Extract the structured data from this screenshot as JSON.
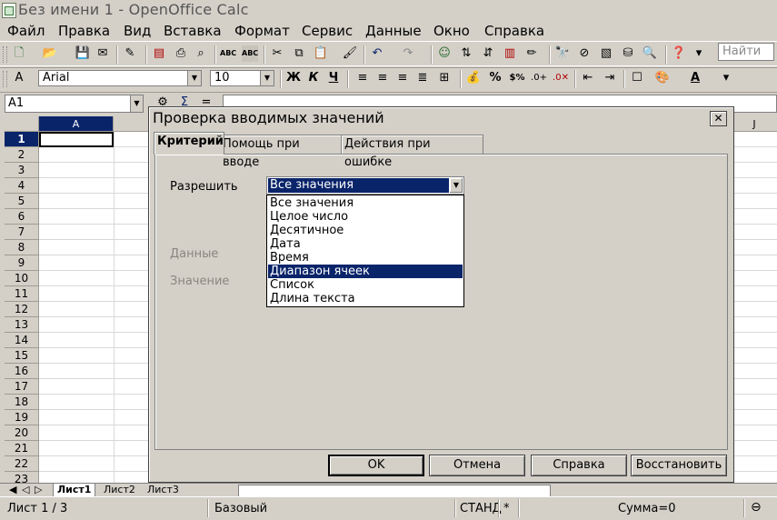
{
  "window": {
    "title": "Без имени 1 - OpenOffice Calc"
  },
  "menu": [
    "Файл",
    "Правка",
    "Вид",
    "Вставка",
    "Формат",
    "Сервис",
    "Данные",
    "Окно",
    "Справка"
  ],
  "toolbar": {
    "find_placeholder": "Найти",
    "font_name": "Arial",
    "font_size": "10",
    "bold_label": "Ж",
    "italic_label": "К",
    "underline_label": "Ч"
  },
  "formula_bar": {
    "name_box": "A1"
  },
  "sheet": {
    "selected_column": "A",
    "column_j": "J",
    "rows": [
      "1",
      "2",
      "3",
      "4",
      "5",
      "6",
      "7",
      "8",
      "9",
      "10",
      "11",
      "12",
      "13",
      "14",
      "15",
      "16",
      "17",
      "18",
      "19",
      "20",
      "21",
      "22",
      "23"
    ],
    "tabs": [
      "Лист1",
      "Лист2",
      "Лист3"
    ]
  },
  "status": {
    "sheet": "Лист 1 / 3",
    "style": "Базовый",
    "mode": "СТАНД",
    "modified": "*",
    "sum": "Сумма=0"
  },
  "dialog": {
    "title": "Проверка вводимых значений",
    "tabs": [
      "Критерий",
      "Помощь при вводе",
      "Действия при ошибке"
    ],
    "allow_label": "Разрешить",
    "allow_value": "Все значения",
    "data_label": "Данные",
    "value_label": "Значение",
    "options": [
      "Все значения",
      "Целое число",
      "Десятичное",
      "Дата",
      "Время",
      "Диапазон ячеек",
      "Список",
      "Длина текста"
    ],
    "highlighted_option": "Диапазон ячеек",
    "buttons": {
      "ok": "OK",
      "cancel": "Отмена",
      "help": "Справка",
      "reset": "Восстановить"
    }
  }
}
